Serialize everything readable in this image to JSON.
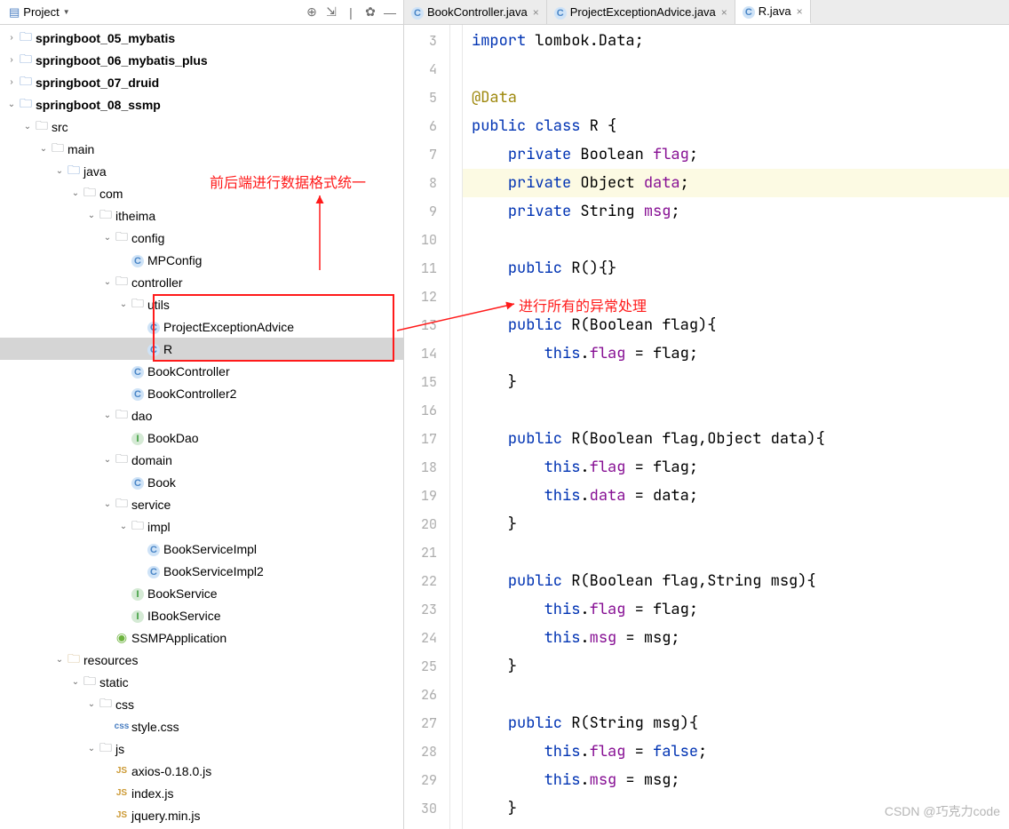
{
  "sidebar": {
    "title": "Project",
    "toolbar_icons": [
      "target",
      "expand",
      "divider",
      "gear",
      "hide"
    ],
    "items": [
      {
        "indent": 0,
        "chev": ">",
        "icon": "folder-blue",
        "label": "springboot_05_mybatis",
        "bold": true
      },
      {
        "indent": 0,
        "chev": ">",
        "icon": "folder-blue",
        "label": "springboot_06_mybatis_plus",
        "bold": true
      },
      {
        "indent": 0,
        "chev": ">",
        "icon": "folder-blue",
        "label": "springboot_07_druid",
        "bold": true
      },
      {
        "indent": 0,
        "chev": "v",
        "icon": "folder-blue",
        "label": "springboot_08_ssmp",
        "bold": true
      },
      {
        "indent": 1,
        "chev": "v",
        "icon": "folder",
        "label": "src"
      },
      {
        "indent": 2,
        "chev": "v",
        "icon": "folder",
        "label": "main"
      },
      {
        "indent": 3,
        "chev": "v",
        "icon": "folder-blue",
        "label": "java"
      },
      {
        "indent": 4,
        "chev": "v",
        "icon": "pkg",
        "label": "com"
      },
      {
        "indent": 5,
        "chev": "v",
        "icon": "pkg",
        "label": "itheima"
      },
      {
        "indent": 6,
        "chev": "v",
        "icon": "pkg",
        "label": "config"
      },
      {
        "indent": 7,
        "chev": "",
        "icon": "class",
        "label": "MPConfig"
      },
      {
        "indent": 6,
        "chev": "v",
        "icon": "pkg",
        "label": "controller"
      },
      {
        "indent": 7,
        "chev": "v",
        "icon": "pkg",
        "label": "utils"
      },
      {
        "indent": 8,
        "chev": "",
        "icon": "class",
        "label": "ProjectExceptionAdvice"
      },
      {
        "indent": 8,
        "chev": "",
        "icon": "class",
        "label": "R",
        "selected": true
      },
      {
        "indent": 7,
        "chev": "",
        "icon": "class",
        "label": "BookController"
      },
      {
        "indent": 7,
        "chev": "",
        "icon": "class",
        "label": "BookController2"
      },
      {
        "indent": 6,
        "chev": "v",
        "icon": "pkg",
        "label": "dao"
      },
      {
        "indent": 7,
        "chev": "",
        "icon": "interface",
        "label": "BookDao"
      },
      {
        "indent": 6,
        "chev": "v",
        "icon": "pkg",
        "label": "domain"
      },
      {
        "indent": 7,
        "chev": "",
        "icon": "class",
        "label": "Book"
      },
      {
        "indent": 6,
        "chev": "v",
        "icon": "pkg",
        "label": "service"
      },
      {
        "indent": 7,
        "chev": "v",
        "icon": "pkg",
        "label": "impl"
      },
      {
        "indent": 8,
        "chev": "",
        "icon": "class",
        "label": "BookServiceImpl"
      },
      {
        "indent": 8,
        "chev": "",
        "icon": "class",
        "label": "BookServiceImpl2"
      },
      {
        "indent": 7,
        "chev": "",
        "icon": "interface",
        "label": "BookService"
      },
      {
        "indent": 7,
        "chev": "",
        "icon": "interface",
        "label": "IBookService"
      },
      {
        "indent": 6,
        "chev": "",
        "icon": "spring",
        "label": "SSMPApplication"
      },
      {
        "indent": 3,
        "chev": "v",
        "icon": "folder-res",
        "label": "resources"
      },
      {
        "indent": 4,
        "chev": "v",
        "icon": "folder",
        "label": "static"
      },
      {
        "indent": 5,
        "chev": "v",
        "icon": "folder",
        "label": "css"
      },
      {
        "indent": 6,
        "chev": "",
        "icon": "css",
        "label": "style.css"
      },
      {
        "indent": 5,
        "chev": "v",
        "icon": "folder",
        "label": "js"
      },
      {
        "indent": 6,
        "chev": "",
        "icon": "js",
        "label": "axios-0.18.0.js"
      },
      {
        "indent": 6,
        "chev": "",
        "icon": "js",
        "label": "index.js"
      },
      {
        "indent": 6,
        "chev": "",
        "icon": "js",
        "label": "jquery.min.js"
      }
    ]
  },
  "tabs": [
    {
      "icon": "class",
      "label": "BookController.java",
      "active": false
    },
    {
      "icon": "class",
      "label": "ProjectExceptionAdvice.java",
      "active": false
    },
    {
      "icon": "class",
      "label": "R.java",
      "active": true
    }
  ],
  "annotations": {
    "text1": "前后端进行数据格式统一",
    "text2": "进行所有的异常处理"
  },
  "code_lines": [
    {
      "n": 3,
      "html": "<span class='kw'>import</span> lombok.Data;"
    },
    {
      "n": 4,
      "html": ""
    },
    {
      "n": 5,
      "html": "<span class='ann'>@Data</span>"
    },
    {
      "n": 6,
      "html": "<span class='kw'>public class</span> R {"
    },
    {
      "n": 7,
      "html": "    <span class='kw'>private</span> Boolean <span class='field'>flag</span>;"
    },
    {
      "n": 8,
      "html": "    <span class='kw'>private</span> Object <span class='field'>data</span>;",
      "hl": true
    },
    {
      "n": 9,
      "html": "    <span class='kw'>private</span> String <span class='field'>msg</span>;"
    },
    {
      "n": 10,
      "html": ""
    },
    {
      "n": 11,
      "html": "    <span class='kw'>public</span> R(){}"
    },
    {
      "n": 12,
      "html": ""
    },
    {
      "n": 13,
      "html": "    <span class='kw'>public</span> R(Boolean flag){"
    },
    {
      "n": 14,
      "html": "        <span class='kw'>this</span>.<span class='field'>flag</span> = flag;"
    },
    {
      "n": 15,
      "html": "    }"
    },
    {
      "n": 16,
      "html": ""
    },
    {
      "n": 17,
      "html": "    <span class='kw'>public</span> R(Boolean flag,Object data){"
    },
    {
      "n": 18,
      "html": "        <span class='kw'>this</span>.<span class='field'>flag</span> = flag;"
    },
    {
      "n": 19,
      "html": "        <span class='kw'>this</span>.<span class='field'>data</span> = data;"
    },
    {
      "n": 20,
      "html": "    }"
    },
    {
      "n": 21,
      "html": ""
    },
    {
      "n": 22,
      "html": "    <span class='kw'>public</span> R(Boolean flag,String msg){"
    },
    {
      "n": 23,
      "html": "        <span class='kw'>this</span>.<span class='field'>flag</span> = flag;"
    },
    {
      "n": 24,
      "html": "        <span class='kw'>this</span>.<span class='field'>msg</span> = msg;"
    },
    {
      "n": 25,
      "html": "    }"
    },
    {
      "n": 26,
      "html": ""
    },
    {
      "n": 27,
      "html": "    <span class='kw'>public</span> R(String msg){"
    },
    {
      "n": 28,
      "html": "        <span class='kw'>this</span>.<span class='field'>flag</span> = <span class='kw'>false</span>;"
    },
    {
      "n": 29,
      "html": "        <span class='kw'>this</span>.<span class='field'>msg</span> = msg;"
    },
    {
      "n": 30,
      "html": "    }"
    }
  ],
  "watermark": "CSDN @巧克力code"
}
